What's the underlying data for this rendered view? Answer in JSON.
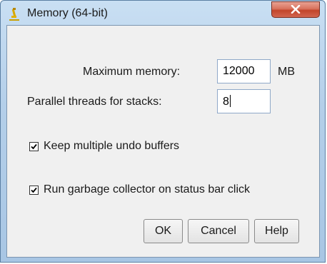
{
  "window": {
    "title": "Memory (64-bit)",
    "app_icon": "microscope-icon",
    "close_icon": "close-icon"
  },
  "form": {
    "max_memory": {
      "label": "Maximum memory:",
      "value": "12000",
      "unit": "MB"
    },
    "parallel_threads": {
      "label": "Parallel threads for stacks:",
      "value": "8"
    }
  },
  "options": [
    {
      "label": "Keep multiple undo buffers",
      "checked": true
    },
    {
      "label": "Run garbage collector on status bar click",
      "checked": true
    }
  ],
  "buttons": {
    "ok": "OK",
    "cancel": "Cancel",
    "help": "Help"
  },
  "colors": {
    "close_button": "#c9523a",
    "frame": "#b4cfe9",
    "client": "#f0f0f0"
  }
}
